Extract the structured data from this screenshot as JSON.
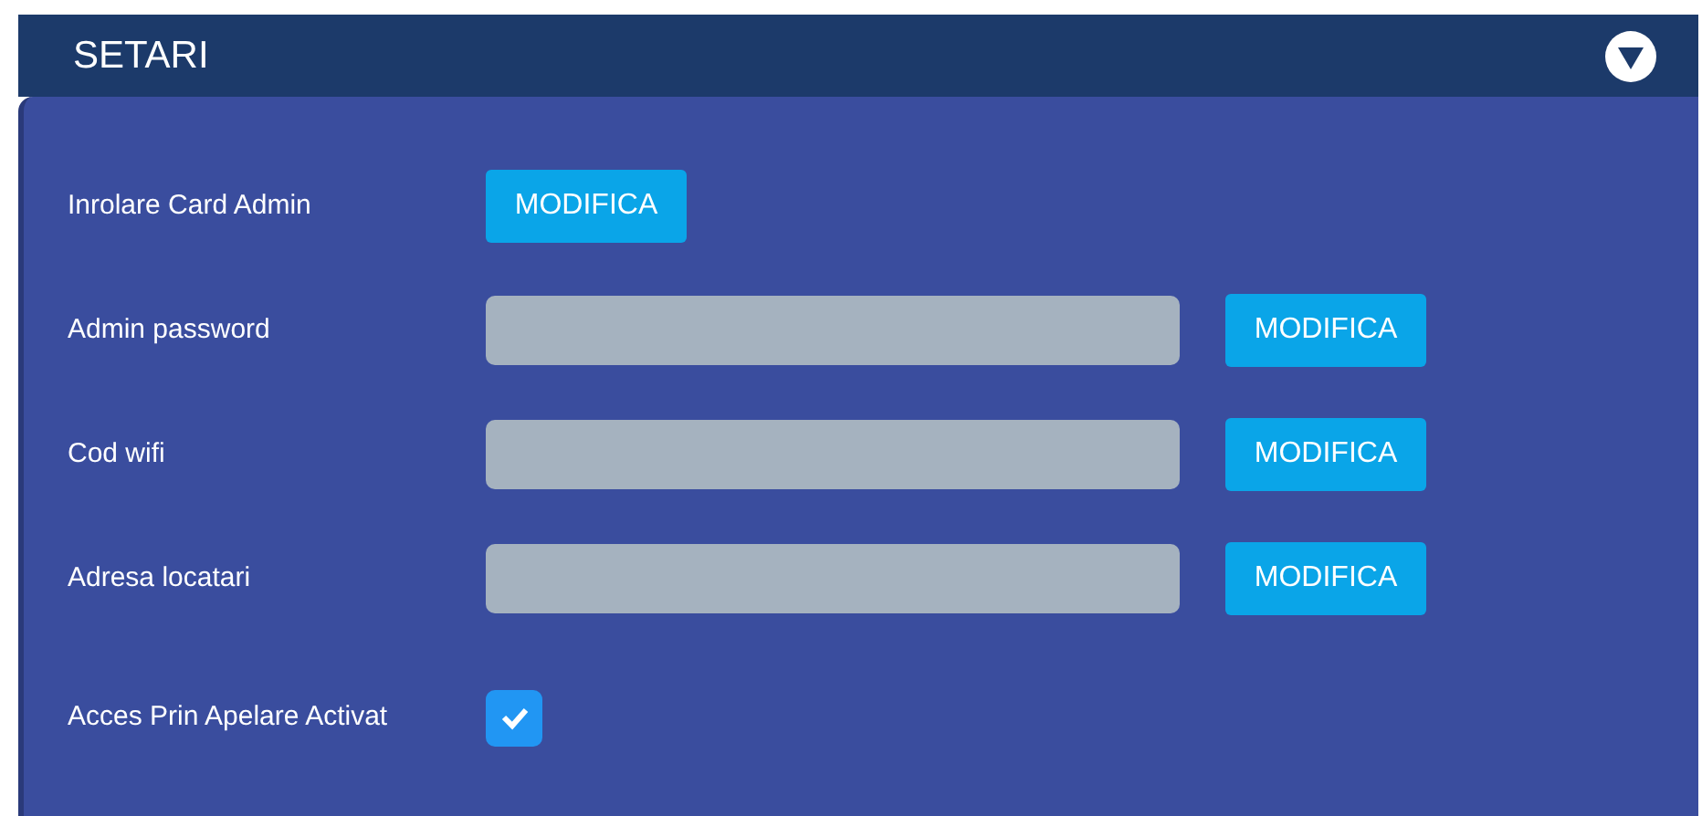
{
  "header": {
    "title": "SETARI"
  },
  "rows": [
    {
      "kind": "button",
      "label": "Inrolare Card Admin",
      "button": "MODIFICA"
    },
    {
      "kind": "field",
      "label": "Admin password",
      "button": "MODIFICA"
    },
    {
      "kind": "field",
      "label": "Cod wifi",
      "button": "MODIFICA"
    },
    {
      "kind": "field",
      "label": "Adresa locatari",
      "button": "MODIFICA"
    },
    {
      "kind": "checkbox",
      "label": "Acces Prin Apelare Activat",
      "checked": true
    }
  ]
}
